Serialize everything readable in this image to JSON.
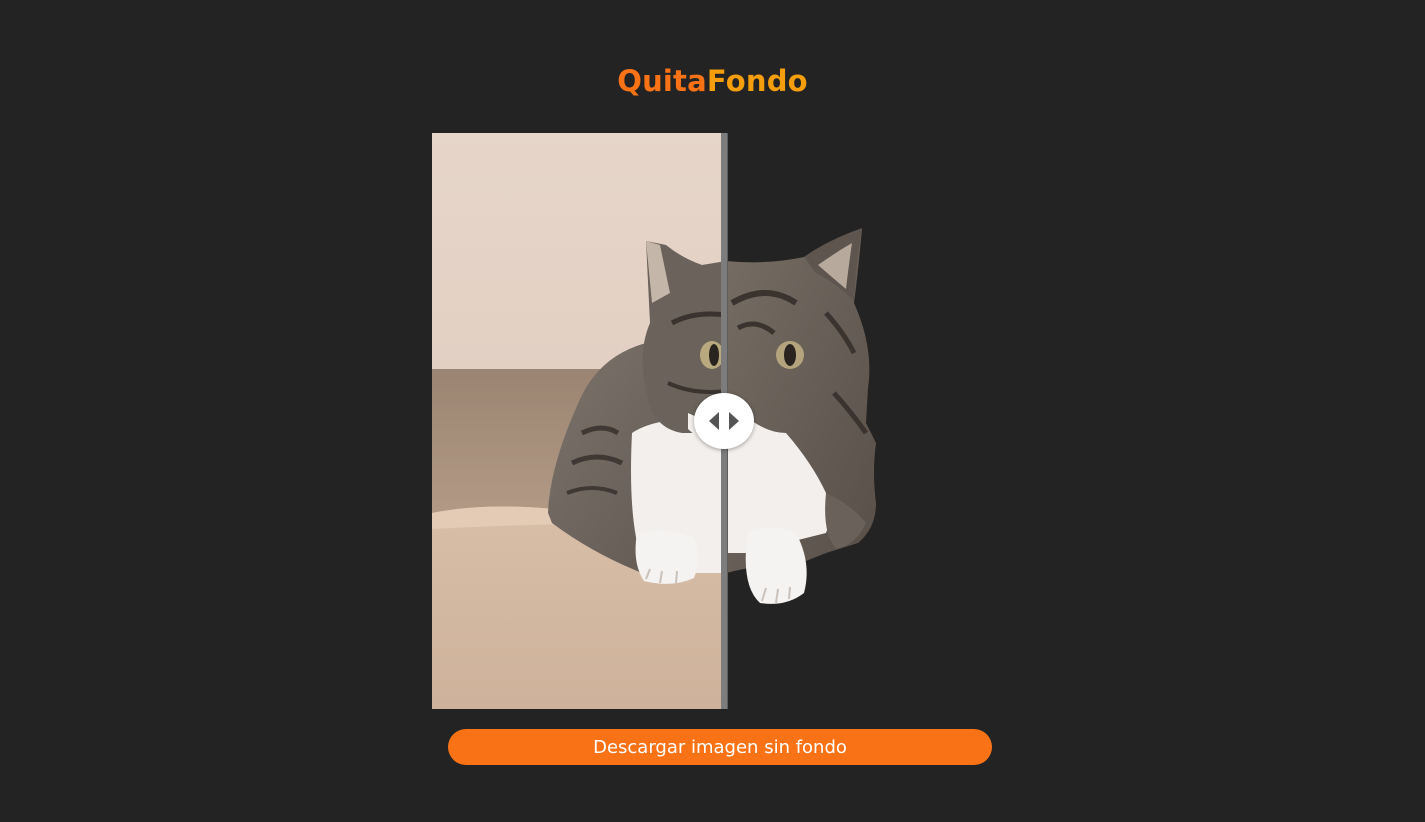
{
  "header": {
    "logo_part1": "Quita",
    "logo_part2": "Fondo"
  },
  "comparison": {
    "original_image": "cat-photo-with-background",
    "result_image": "cat-photo-background-removed",
    "handle_icon": "left-right-arrows-icon"
  },
  "actions": {
    "download_label": "Descargar imagen sin fondo"
  },
  "colors": {
    "background": "#232323",
    "accent_orange": "#f97316",
    "accent_amber": "#f59e0b"
  }
}
